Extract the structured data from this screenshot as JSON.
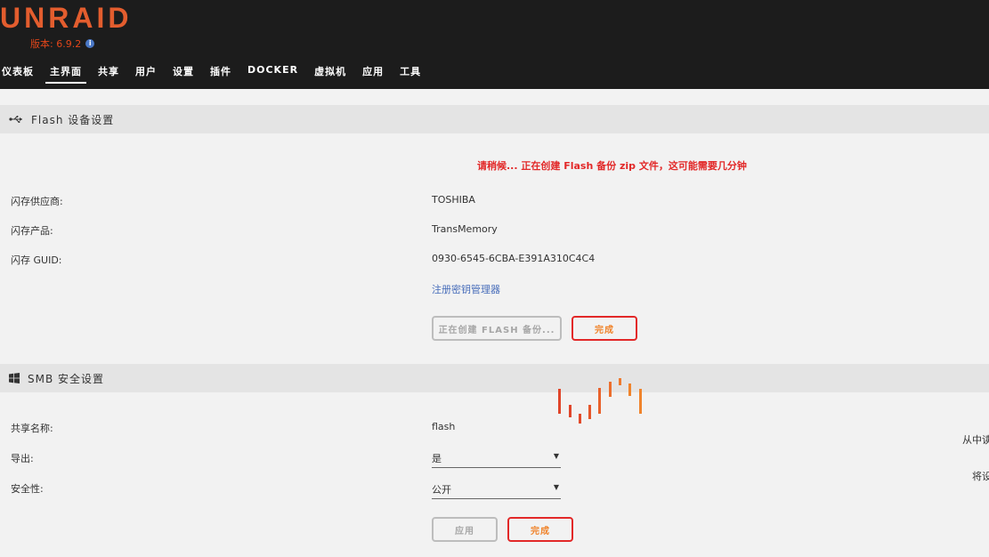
{
  "header": {
    "logo": "UNRAID",
    "version": "版本: 6.9.2",
    "nav": [
      "仪表板",
      "主界面",
      "共享",
      "用户",
      "设置",
      "插件",
      "DOCKER",
      "虚拟机",
      "应用",
      "工具"
    ],
    "active_nav": "主界面"
  },
  "flash_section": {
    "title": "Flash 设备设置",
    "notice": "请稍候... 正在创建 Flash 备份 zip 文件，这可能需要几分钟",
    "fields": [
      {
        "label": "闪存供应商:",
        "value": "TOSHIBA"
      },
      {
        "label": "闪存产品:",
        "value": "TransMemory"
      },
      {
        "label": "闪存 GUID:",
        "value": "0930-6545-6CBA-E391A310C4C4"
      }
    ],
    "link": "注册密钥管理器",
    "backup_button": "正在创建 FLASH 备份...",
    "done_button": "完成"
  },
  "smb_section": {
    "title": "SMB 安全设置",
    "share_name_label": "共享名称:",
    "share_name_value": "flash",
    "export_label": "导出:",
    "export_value": "是",
    "security_label": "安全性:",
    "security_value": "公开",
    "apply_button": "应用",
    "done_button": "完成",
    "side_text_1": "从中读",
    "side_text_2": "将设"
  },
  "colors": {
    "header_bg": "#1c1c1c",
    "brand": "#e35d2e",
    "alert": "#e22828",
    "link": "#486dba",
    "done_text": "#f0842c"
  }
}
